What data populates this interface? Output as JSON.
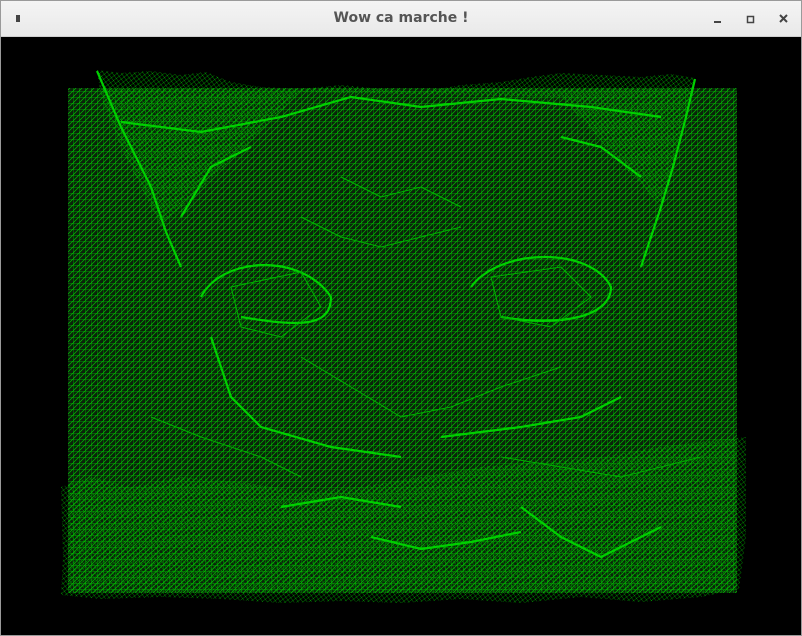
{
  "window": {
    "title": "Wow ca marche !",
    "controls": [
      "minimize",
      "maximize",
      "close"
    ]
  },
  "scene": {
    "background": "#000000",
    "wire_color": "#00c800",
    "description_icon": "green-wireframe-heightmap-mesh"
  }
}
